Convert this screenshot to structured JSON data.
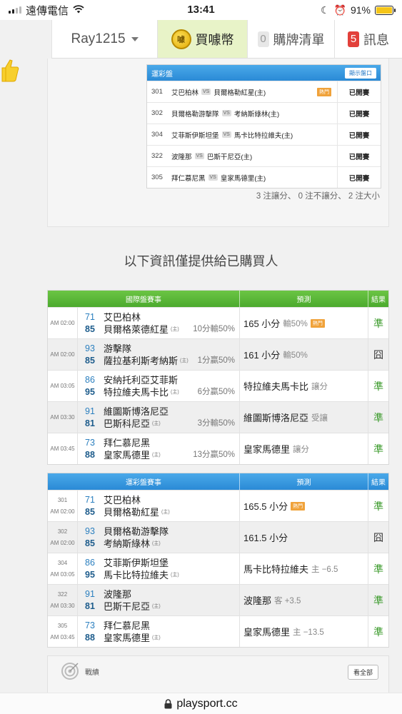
{
  "status_bar": {
    "carrier": "遠傳電信",
    "time": "13:41",
    "battery": "91%"
  },
  "nav": {
    "username": "Ray1215",
    "buy_label": "買噱幣",
    "coin_glyph": "噱",
    "cart_count": "0",
    "cart_label": "購牌清單",
    "msg_count": "5",
    "msg_label": "訊息"
  },
  "lotto_panel": {
    "title": "運彩盤",
    "toggle_label": "顯示盤口",
    "vs_label": "VS",
    "hot_label": "熱門",
    "rows": [
      {
        "num": "301",
        "away": "艾巴柏林",
        "home": "貝爾格勒紅星(主)",
        "hot": true,
        "state": "已開賽"
      },
      {
        "num": "302",
        "away": "貝爾格勒游擊隊",
        "home": "考納斯綠林(主)",
        "hot": false,
        "state": "已開賽"
      },
      {
        "num": "304",
        "away": "艾菲斯伊斯坦堡",
        "home": "馬卡比特拉維夫(主)",
        "hot": false,
        "state": "已開賽"
      },
      {
        "num": "322",
        "away": "波隆那",
        "home": "巴斯干尼亞(主)",
        "hot": false,
        "state": "已開賽"
      },
      {
        "num": "305",
        "away": "拜仁慕尼黑",
        "home": "皇家馬德里(主)",
        "hot": false,
        "state": "已開賽"
      }
    ],
    "summary": "3 注讓分、 0 注不讓分、 2 注大小"
  },
  "info_title": "以下資訊僅提供給已購買人",
  "intl_table": {
    "headers": {
      "match": "國際盤賽事",
      "pred": "預測",
      "result": "結果"
    },
    "rows": [
      {
        "time": "AM 02:00",
        "away_score": "71",
        "away": "艾巴柏林",
        "home_score": "85",
        "home": "貝爾格萊德紅星",
        "home_tag": "(主)",
        "handicap": "10分輸50%",
        "pick": "165 小分",
        "pick_note": "輸50%",
        "hot": true,
        "result": "準",
        "hit": true
      },
      {
        "time": "AM 02:00",
        "away_score": "93",
        "away": "游擊隊",
        "home_score": "85",
        "home": "薩拉基利斯考納斯",
        "home_tag": "(主)",
        "handicap": "1分贏50%",
        "pick": "161 小分",
        "pick_note": "輸50%",
        "hot": false,
        "result": "囧",
        "hit": false
      },
      {
        "time": "AM 03:05",
        "away_score": "86",
        "away": "安納托利亞艾菲斯",
        "home_score": "95",
        "home": "特拉維夫馬卡比",
        "home_tag": "(主)",
        "handicap": "6分贏50%",
        "pick": "特拉維夫馬卡比",
        "pick_note": "讓分",
        "hot": false,
        "result": "準",
        "hit": true
      },
      {
        "time": "AM 03:30",
        "away_score": "91",
        "away": "維圖斯博洛尼亞",
        "home_score": "81",
        "home": "巴斯科尼亞",
        "home_tag": "(主)",
        "handicap": "3分輸50%",
        "pick": "維圖斯博洛尼亞",
        "pick_note": "受讓",
        "hot": false,
        "result": "準",
        "hit": true
      },
      {
        "time": "AM 03:45",
        "away_score": "73",
        "away": "拜仁慕尼黑",
        "home_score": "88",
        "home": "皇家馬德里",
        "home_tag": "(主)",
        "handicap": "13分贏50%",
        "pick": "皇家馬德里",
        "pick_note": "讓分",
        "hot": false,
        "result": "準",
        "hit": true
      }
    ]
  },
  "lotto_table": {
    "headers": {
      "match": "運彩盤賽事",
      "pred": "預測",
      "result": "結果"
    },
    "rows": [
      {
        "num": "301",
        "time": "AM 02:00",
        "away_score": "71",
        "away": "艾巴柏林",
        "home_score": "85",
        "home": "貝爾格勒紅星",
        "home_tag": "(主)",
        "pick": "165.5 小分",
        "pick_note": "",
        "hot": true,
        "result": "準",
        "hit": true
      },
      {
        "num": "302",
        "time": "AM 02:00",
        "away_score": "93",
        "away": "貝爾格勒游擊隊",
        "home_score": "85",
        "home": "考納斯綠林",
        "home_tag": "(主)",
        "pick": "161.5 小分",
        "pick_note": "",
        "hot": false,
        "result": "囧",
        "hit": false
      },
      {
        "num": "304",
        "time": "AM 03:05",
        "away_score": "86",
        "away": "艾菲斯伊斯坦堡",
        "home_score": "95",
        "home": "馬卡比特拉維夫",
        "home_tag": "(主)",
        "pick": "馬卡比特拉維夫",
        "pick_note": "主 −6.5",
        "hot": false,
        "result": "準",
        "hit": true
      },
      {
        "num": "322",
        "time": "AM 03:30",
        "away_score": "91",
        "away": "波隆那",
        "home_score": "81",
        "home": "巴斯干尼亞",
        "home_tag": "(主)",
        "pick": "波隆那",
        "pick_note": "客 +3.5",
        "hot": false,
        "result": "準",
        "hit": true
      },
      {
        "num": "305",
        "time": "AM 03:45",
        "away_score": "73",
        "away": "拜仁慕尼黑",
        "home_score": "88",
        "home": "皇家馬德里",
        "home_tag": "(主)",
        "pick": "皇家馬德里",
        "pick_note": "主 −13.5",
        "hot": false,
        "result": "準",
        "hit": true
      }
    ]
  },
  "record": {
    "label": "戰績",
    "view_all": "看全部"
  },
  "url_bar": {
    "domain": "playsport.cc"
  },
  "colors": {
    "green_header": "#4caa2e",
    "blue_header": "#2a8ad6",
    "hit": "#3a9a2a",
    "badge_red": "#e2403a"
  }
}
